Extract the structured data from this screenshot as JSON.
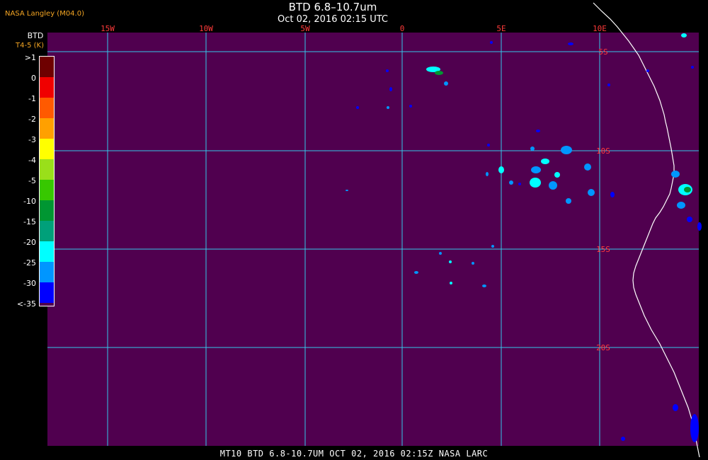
{
  "header": {
    "agency": "NASA Langley (M04.0)",
    "title": "BTD 6.8–10.7um",
    "subtitle": "Oct 02, 2016 02:15 UTC"
  },
  "legend": {
    "title": "BTD",
    "unit_label": "T4-5 (K)",
    "entries": [
      {
        "label": ">1",
        "color": "#6e0000"
      },
      {
        "label": "0",
        "color": "#f00000"
      },
      {
        "label": "-1",
        "color": "#ff5a00"
      },
      {
        "label": "-2",
        "color": "#ffa000"
      },
      {
        "label": "-3",
        "color": "#ffff00"
      },
      {
        "label": "-4",
        "color": "#9adf1a"
      },
      {
        "label": "-5",
        "color": "#37c800"
      },
      {
        "label": "-10",
        "color": "#009632"
      },
      {
        "label": "-15",
        "color": "#00a07a"
      },
      {
        "label": "-20",
        "color": "#00ffff"
      },
      {
        "label": "-25",
        "color": "#0096ff"
      },
      {
        "label": "-30",
        "color": "#0000ff"
      },
      {
        "label": "<-35",
        "color": "#50004f"
      }
    ]
  },
  "map": {
    "background_color": "#50004f",
    "grid_color": "#35c7e8",
    "grid_label_color": "#ff3a3a",
    "coast_color": "#ffffff",
    "lon_labels": [
      "15W",
      "10W",
      "5W",
      "0",
      "5E",
      "10E"
    ],
    "lat_labels": [
      "5S",
      "10S",
      "15S",
      "20S"
    ]
  },
  "footer": {
    "text": "MT10  BTD 6.8-10.7UM   OCT 02, 2016 02:15Z   NASA LARC"
  }
}
